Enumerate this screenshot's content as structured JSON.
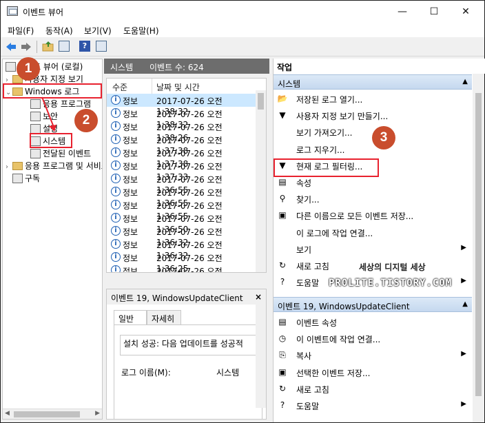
{
  "window": {
    "title": "이벤트 뷰어"
  },
  "menu": [
    "파일(F)",
    "동작(A)",
    "보기(V)",
    "도움말(H)"
  ],
  "tree": {
    "root": "이벤트 뷰어 (로컬)",
    "custom_views": "사용자 지정 보기",
    "windows_logs": "Windows 로그",
    "logs": [
      "응용 프로그램",
      "보안",
      "설정",
      "시스템",
      "전달된 이벤트"
    ],
    "apps_services": "응용 프로그램 및 서비스 로그",
    "subscriptions": "구독"
  },
  "middle": {
    "title": "시스템",
    "count_label": "이벤트 수: 624"
  },
  "events": {
    "col_level": "수준",
    "col_datetime": "날짜 및 시간",
    "rows": [
      {
        "level": "정보",
        "datetime": "2017-07-26 오전 1:38:32"
      },
      {
        "level": "정보",
        "datetime": "2017-07-26 오전 1:38:32"
      },
      {
        "level": "정보",
        "datetime": "2017-07-26 오전 1:38:26"
      },
      {
        "level": "정보",
        "datetime": "2017-07-26 오전 1:37:38"
      },
      {
        "level": "정보",
        "datetime": "2017-07-26 오전 1:37:38"
      },
      {
        "level": "정보",
        "datetime": "2017-07-26 오전 1:37:33"
      },
      {
        "level": "정보",
        "datetime": "2017-07-26 오전 1:36:55"
      },
      {
        "level": "정보",
        "datetime": "2017-07-26 오전 1:36:55"
      },
      {
        "level": "정보",
        "datetime": "2017-07-26 오전 1:36:55"
      },
      {
        "level": "정보",
        "datetime": "2017-07-26 오전 1:36:50"
      },
      {
        "level": "정보",
        "datetime": "2017-07-26 오전 1:36:32"
      },
      {
        "level": "정보",
        "datetime": "2017-07-26 오전 1:36:32"
      },
      {
        "level": "정보",
        "datetime": "2017-07-26 오전 1:36:25"
      },
      {
        "level": "정보",
        "datetime": "2017-07-26 오전 1:36:25"
      }
    ]
  },
  "detail": {
    "title": "이벤트 19, WindowsUpdateClient",
    "close": "×",
    "tab_general": "일반",
    "tab_details": "자세히",
    "message": "설치 성공: 다음 업데이트를 성공적",
    "log_name_label": "로그 이름(M):",
    "log_name_value": "시스템"
  },
  "actions": {
    "header": "작업",
    "section1": "시스템",
    "items1": [
      "저장된 로그 열기...",
      "사용자 지정 보기 만들기...",
      "보기 가져오기...",
      "로그 지우기...",
      "현재 로그 필터링...",
      "속성",
      "찾기...",
      "다른 이름으로 모든 이벤트 저장...",
      "이 로그에 작업 연결...",
      "보기",
      "새로 고침",
      "도움말"
    ],
    "section2": "이벤트 19, WindowsUpdateClient",
    "items2": [
      "이벤트 속성",
      "이 이벤트에 작업 연결...",
      "복사",
      "선택한 이벤트 저장...",
      "새로 고침",
      "도움말"
    ]
  },
  "badges": [
    "1",
    "2",
    "3"
  ],
  "watermark": {
    "line1": "세상의 디지털 세상",
    "line2": "PROLITE.TISTORY.COM"
  },
  "colors": {
    "annotation_red": "#e8212e",
    "badge": "#c94d2d",
    "selected_row": "#cce8ff",
    "pane_header": "#6d6d6d"
  }
}
